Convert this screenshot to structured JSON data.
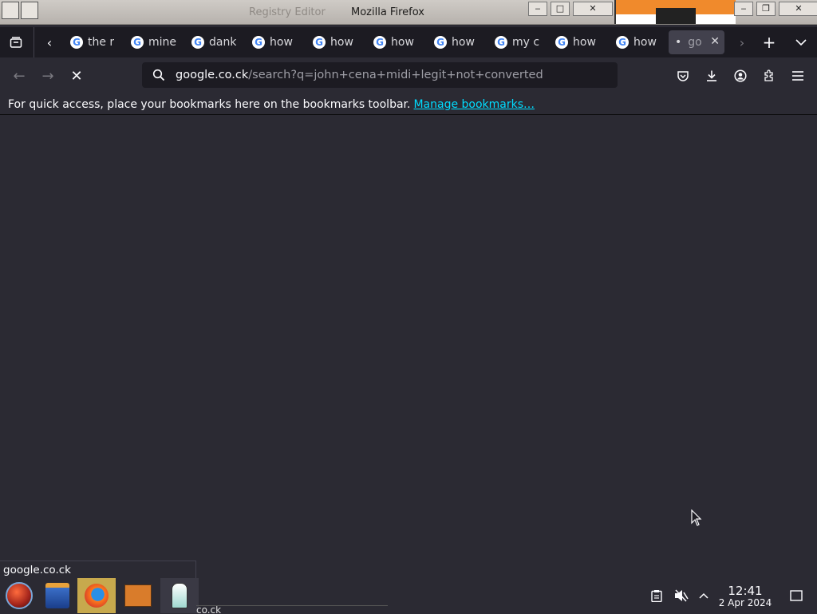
{
  "window": {
    "ghost_title": "Registry Editor",
    "title": "Mozilla Firefox"
  },
  "tabs": [
    {
      "label": "the r"
    },
    {
      "label": "mine"
    },
    {
      "label": "dank"
    },
    {
      "label": "how"
    },
    {
      "label": "how"
    },
    {
      "label": "how"
    },
    {
      "label": "how"
    },
    {
      "label": "my c"
    },
    {
      "label": "how"
    },
    {
      "label": "how"
    },
    {
      "label": "go",
      "active": true
    }
  ],
  "address_bar": {
    "host": "google.co.ck",
    "path": "/search?q=john+cena+midi+legit+not+converted"
  },
  "bookmarks_bar": {
    "message": "For quick access, place your bookmarks here on the bookmarks toolbar.",
    "link": "Manage bookmarks…"
  },
  "status": {
    "url": "google.co.ck"
  },
  "taskbar": {
    "ghost_text": "co.ck",
    "clock_time": "12:41",
    "clock_date": "2 Apr 2024"
  },
  "colors": {
    "page_bg": "#2b2a33",
    "tabbar_bg": "#1c1b22",
    "link": "#00ddff",
    "taskbar_active": "#c7a94d"
  }
}
